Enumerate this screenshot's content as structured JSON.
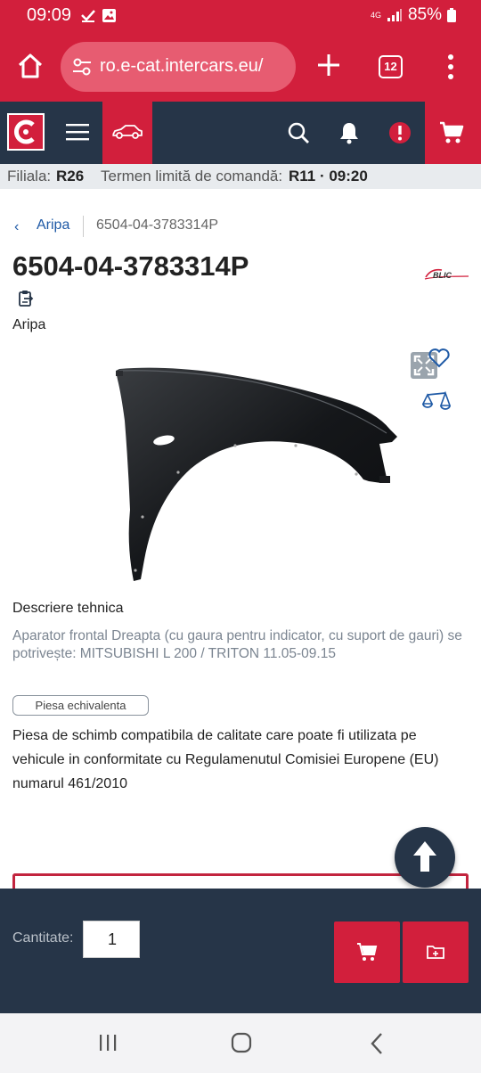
{
  "status_bar": {
    "time": "09:09",
    "network": "4G",
    "battery": "85%"
  },
  "browser": {
    "url": "ro.e-cat.intercars.eu/",
    "tab_count": "12"
  },
  "info_bar": {
    "branch_label": "Filiala:",
    "branch_value": "R26",
    "deadline_label": "Termen limită de comandă:",
    "deadline_value": "R11 · 09:20"
  },
  "breadcrumb": {
    "back_glyph": "‹",
    "parent": "Aripa",
    "current": "6504-04-3783314P"
  },
  "product": {
    "code": "6504-04-3783314P",
    "category": "Aripa",
    "brand_logo": "BLIC",
    "description_title": "Descriere tehnica",
    "description": "Aparator frontal Dreapta (cu gaura pentru indicator, cu suport de gauri) se potrivește: MITSUBISHI L 200 / TRITON 11.05-09.15",
    "badge": "Piesa echivalenta",
    "badge_text": "Piesa de schimb compatibila de calitate care poate fi utilizata pe vehicule in conformitate cu Regulamenutul Comisiei Europene (EU) numarul 461/2010"
  },
  "action_bar": {
    "quantity_label": "Cantitate:",
    "quantity_value": "1"
  },
  "colors": {
    "brand_red": "#d21f3c",
    "header_navy": "#263548",
    "link_blue": "#1f5aa6"
  }
}
